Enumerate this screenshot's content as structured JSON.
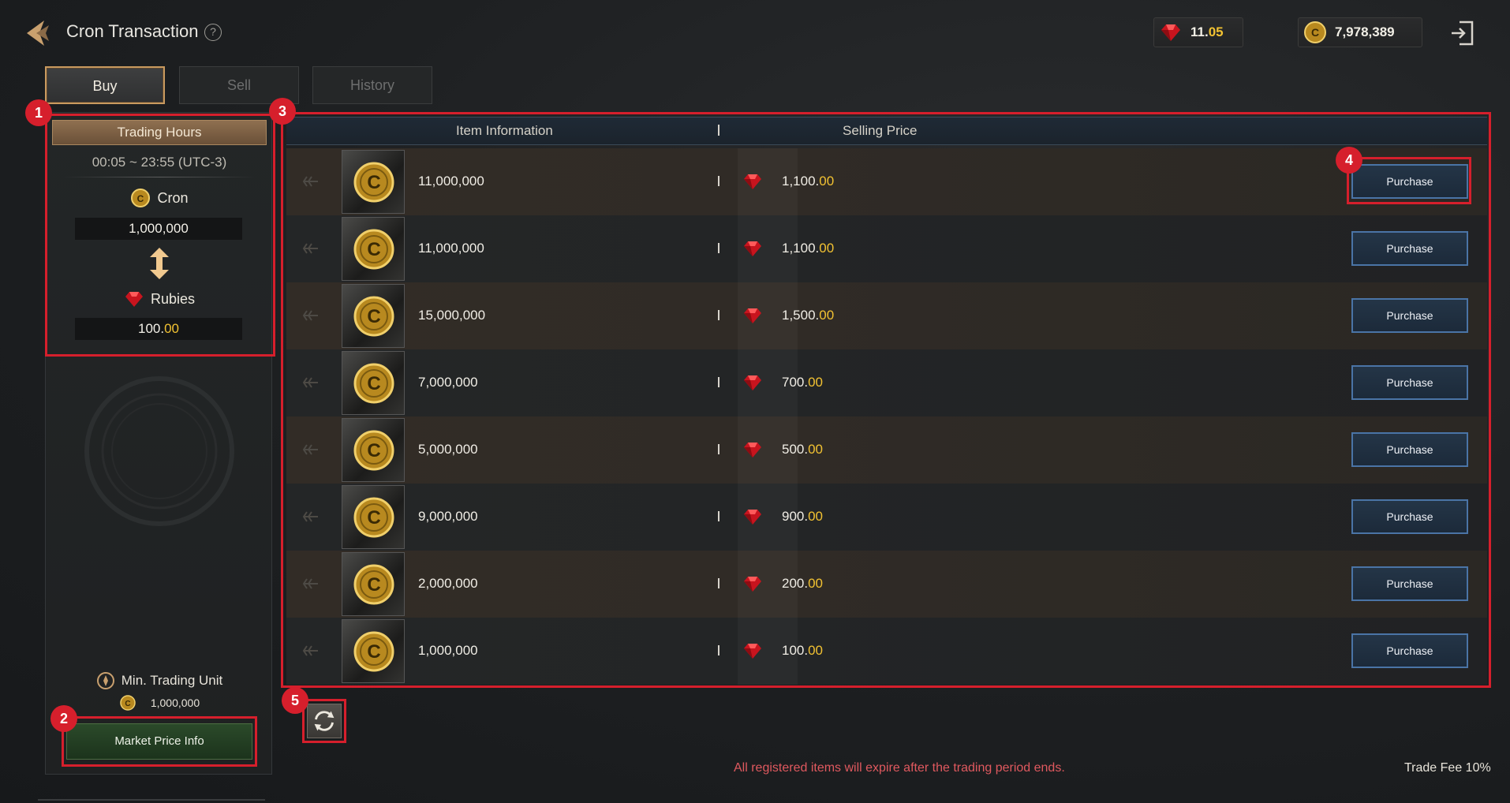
{
  "header": {
    "title": "Cron Transaction",
    "help_symbol": "?",
    "rubies": {
      "whole": "11.",
      "decimals": "05",
      "icon": "ruby-icon"
    },
    "cron": {
      "amount": "7,978,389",
      "icon": "cron-coin-icon"
    },
    "exit_icon": "exit-icon"
  },
  "tabs": [
    {
      "label": "Buy",
      "active": true
    },
    {
      "label": "Sell",
      "active": false
    },
    {
      "label": "History",
      "active": false
    }
  ],
  "left_panel": {
    "trading_hours_title": "Trading Hours",
    "trading_hours": "00:05 ~ 23:55 (UTC-3)",
    "cron_label": "Cron",
    "cron_value": "1,000,000",
    "rubies_label": "Rubies",
    "rubies_value_whole": "100.",
    "rubies_value_decimals": "00",
    "min_unit_label": "Min. Trading Unit",
    "min_unit_value": "1,000,000",
    "market_button": "Market Price Info"
  },
  "table": {
    "col_item": "Item Information",
    "col_price": "Selling Price",
    "rows": [
      {
        "amount": "11,000,000",
        "price_whole": "1,100.",
        "price_decimals": "00",
        "button": "Purchase"
      },
      {
        "amount": "11,000,000",
        "price_whole": "1,100.",
        "price_decimals": "00",
        "button": "Purchase"
      },
      {
        "amount": "15,000,000",
        "price_whole": "1,500.",
        "price_decimals": "00",
        "button": "Purchase"
      },
      {
        "amount": "7,000,000",
        "price_whole": "700.",
        "price_decimals": "00",
        "button": "Purchase"
      },
      {
        "amount": "5,000,000",
        "price_whole": "500.",
        "price_decimals": "00",
        "button": "Purchase"
      },
      {
        "amount": "9,000,000",
        "price_whole": "900.",
        "price_decimals": "00",
        "button": "Purchase"
      },
      {
        "amount": "2,000,000",
        "price_whole": "200.",
        "price_decimals": "00",
        "button": "Purchase"
      },
      {
        "amount": "1,000,000",
        "price_whole": "100.",
        "price_decimals": "00",
        "button": "Purchase"
      }
    ]
  },
  "annotations": [
    "1",
    "2",
    "3",
    "4",
    "5"
  ],
  "footer": {
    "notice": "All registered items will expire after the trading period ends.",
    "trade_fee": "Trade Fee 10%"
  },
  "colors": {
    "accent_gold": "#f2c232",
    "highlight_red": "#d61f2c",
    "purchase_border": "#4a74a6",
    "notice_red": "#e0595f"
  }
}
